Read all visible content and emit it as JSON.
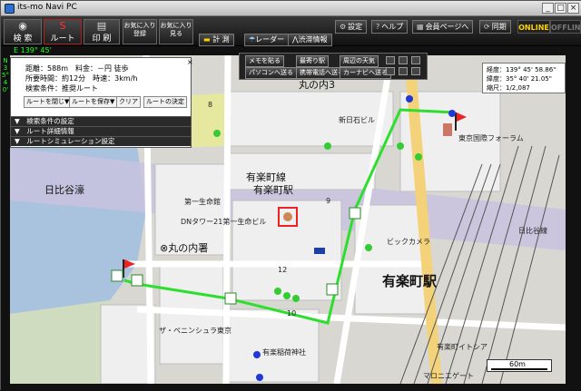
{
  "window": {
    "title": "its-mo Navi PC",
    "min": "_",
    "max": "□",
    "close": "×"
  },
  "toolbar": {
    "search": "検 索",
    "route": "ルート",
    "print": "印 刷",
    "fav_register": "お気に入り\n登録",
    "fav_view": "お気に入り\n見る",
    "settings": "設定",
    "help": "ヘルプ",
    "member_page": "会員ページへ",
    "sync": "同期",
    "online": "ONLINE",
    "offline": "OFFLINE",
    "measure": "計 測",
    "radar": "レーダー",
    "traffic": "渋滞情報"
  },
  "coords": {
    "lat_top": "E 139° 45'",
    "lon_left": "N 35° 40'"
  },
  "route_panel": {
    "distance": "距離：588m　料金：－円 徒歩",
    "time": "所要時間：約12分　時速：3km/h",
    "condition": "検索条件：推奨ルート",
    "buttons": [
      "ルートを閉じ▼",
      "ルートを保存▼",
      "クリア",
      "ルートの決定"
    ],
    "sections": [
      "▼　検索条件の設定",
      "▼　ルート詳細情報",
      "▼　ルートシミュレーション設定"
    ],
    "close": "×"
  },
  "map_controls": {
    "memo": "メモを貼る",
    "nearest_station": "最寄り駅",
    "weather": "周辺の天気",
    "pc_send": "パソコンへ送る",
    "mobile_send": "携帯電話へ送る",
    "carnavi_send": "カーナビへ送る"
  },
  "coord_box": {
    "lon": "経度：139° 45' 58.86\"",
    "lat": "緯度：35° 40' 21.05\"",
    "scale": "縮尺：1/2,087"
  },
  "scale_bar": "60m",
  "map_labels": {
    "hibiya": "日比谷濠",
    "yurakucho_line": "有楽町線",
    "yurakucho_sta": "有楽町駅",
    "marunouchi_sta": "有楽町駅",
    "marunouchi_police": "⊗丸の内署",
    "marunouchi3": "丸の内3",
    "bic": "ビックカメラ",
    "hibiya_line": "日比谷線",
    "tokyo_forum": "東京国際フォーラム",
    "dai_ichi": "第一生命館",
    "dn": "DNタワー21第一生命ビル",
    "peninsula": "ザ・ペニンシュラ東京",
    "inari": "有楽稲荷神社",
    "itocia": "有楽町イトシア",
    "mucc": "マロニエゲート",
    "n12": "12",
    "n10": "10",
    "n9": "9",
    "n8": "8",
    "shin_nisshin": "新日石ビル"
  }
}
